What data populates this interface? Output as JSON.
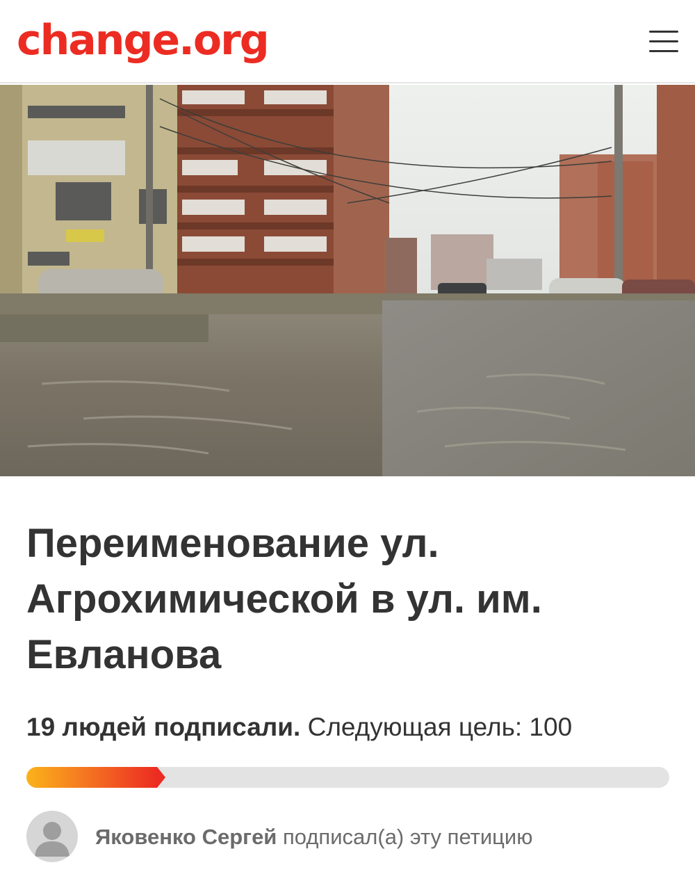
{
  "header": {
    "logo_text": "change.org",
    "logo_color": "#ec2c22",
    "menu_icon": "hamburger-menu-icon"
  },
  "hero": {
    "image_subject": "flooded street between apartment buildings"
  },
  "petition": {
    "title": "Переименование ул. Агрохимической в ул. им. Евланова",
    "signatures_text": "19 людей подписали.",
    "next_goal_text": "Следующая цель: 100",
    "signature_count": 19,
    "goal": 100,
    "progress_fraction": 0.19
  },
  "recent_signer": {
    "name": "Яковенко Сергей",
    "action_text": "подписал(а) эту петицию",
    "avatar_icon": "default-user-avatar-icon"
  }
}
